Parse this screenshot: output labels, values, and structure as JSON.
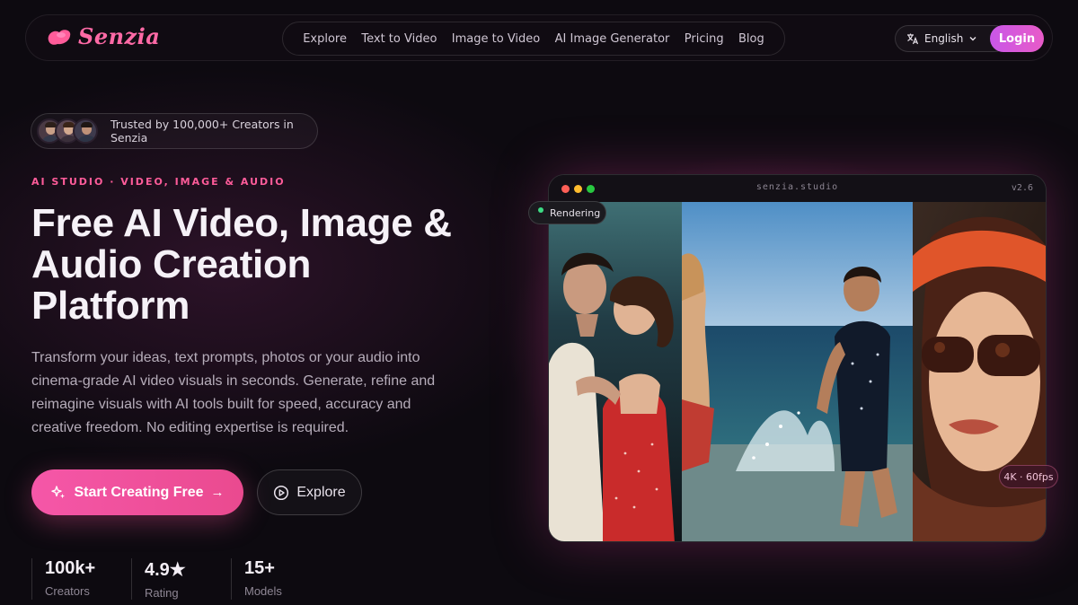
{
  "brand": {
    "name": "Senzia"
  },
  "nav": {
    "items": [
      "Explore",
      "Text to Video",
      "Image to Video",
      "AI Image Generator",
      "Pricing",
      "Blog"
    ],
    "language": "English",
    "login": "Login"
  },
  "hero": {
    "trust_text": "Trusted by 100,000+ Creators in Senzia",
    "eyebrow": "AI STUDIO · VIDEO, IMAGE & AUDIO",
    "title_line1": "Free AI Video, Image &",
    "title_line2": "Audio Creation",
    "title_line3": "Platform",
    "description": "Transform your ideas, text prompts, photos or your audio into cinema-grade AI video visuals in seconds. Generate, refine and reimagine visuals with AI tools built for speed, accuracy and creative freedom. No editing expertise is required.",
    "cta_primary": "Start Creating Free",
    "cta_secondary": "Explore",
    "stats": [
      {
        "value": "100k+",
        "label": "Creators"
      },
      {
        "value": "4.9★",
        "label": "Rating"
      },
      {
        "value": "15+",
        "label": "Models"
      }
    ]
  },
  "studio": {
    "url": "senzia.studio",
    "version": "v2.6",
    "status": "Rendering",
    "quality": "4K · 60fps"
  },
  "colors": {
    "accent": "#ff5c9a",
    "login_gradient": "#c957e8",
    "background": "#0d0a10"
  }
}
